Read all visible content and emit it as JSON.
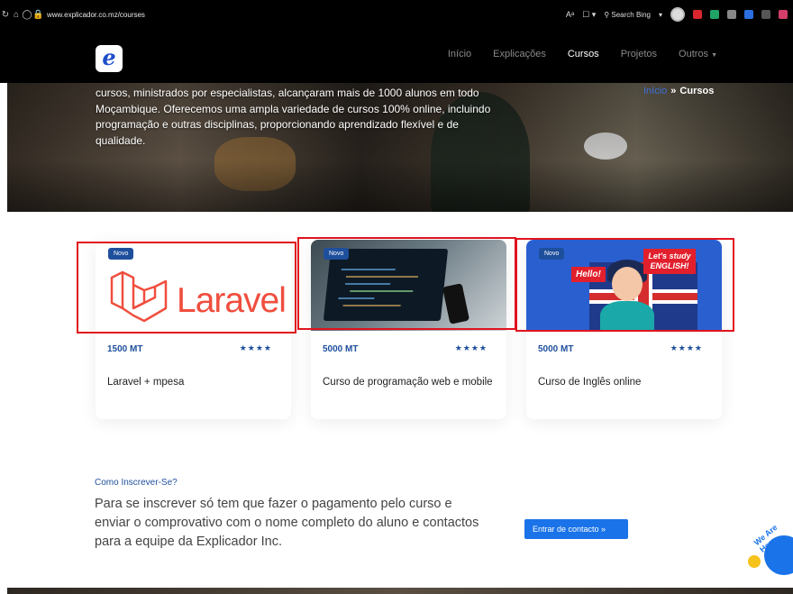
{
  "browser": {
    "url": "www.explicador.co.mz/courses",
    "search_placeholder": "Search Bing"
  },
  "nav": {
    "logo": "e",
    "links": [
      "Início",
      "Explicações",
      "Cursos",
      "Projetos",
      "Outros"
    ],
    "active": "Cursos"
  },
  "hero": {
    "text": "cursos, ministrados por especialistas, alcançaram mais de 1000 alunos em todo Moçambique. Oferecemos uma ampla variedade de cursos 100% online, incluindo programação e outras disciplinas, proporcionando aprendizado flexível e de qualidade.",
    "breadcrumb_home": "Início",
    "breadcrumb_separator": "»",
    "breadcrumb_current": "Cursos"
  },
  "courses": [
    {
      "badge": "Novo",
      "price": "1500 MT",
      "stars": "★★★★",
      "title": "Laravel + mpesa",
      "thumb_text": "Laravel"
    },
    {
      "badge": "Novo",
      "price": "5000 MT",
      "stars": "★★★★",
      "title": "Curso de programação web e mobile"
    },
    {
      "badge": "Novo",
      "price": "5000 MT",
      "stars": "★★★★",
      "title": "Curso de Inglês online",
      "thumb_hello": "Hello!",
      "thumb_study": "Let's study ENGLISH!"
    }
  ],
  "enroll": {
    "label": "Como Inscrever-Se?",
    "text": "Para se inscrever só tem que fazer o pagamento pelo curso e enviar o comprovativo com o nome completo do aluno e contactos para a equipe da Explicador Inc.",
    "button": "Entrar de contacto »"
  },
  "chat": {
    "tag": "We Are Here"
  },
  "colors": {
    "accent": "#1e4f9c",
    "button": "#1a73e8",
    "laravel": "#f04e3e",
    "highlight": "#e0141e"
  }
}
